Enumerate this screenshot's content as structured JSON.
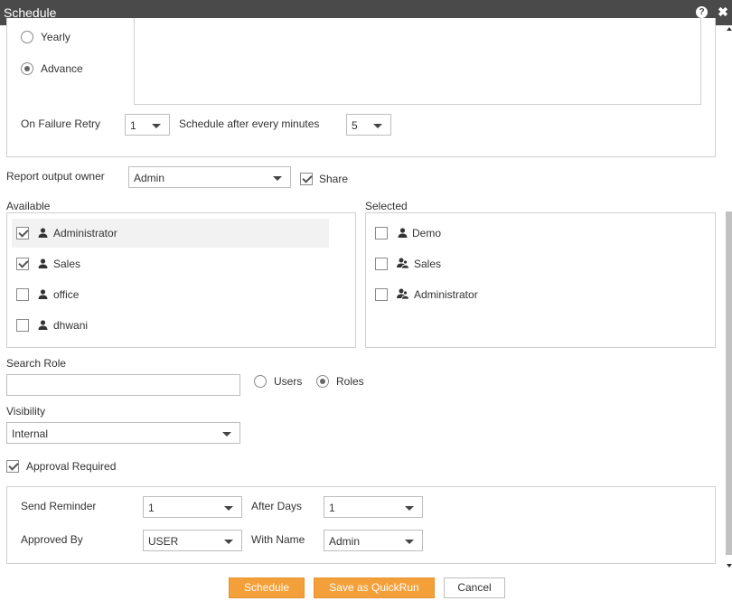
{
  "window": {
    "title": "Schedule",
    "help_icon": "question-icon",
    "close_icon": "close-icon"
  },
  "frequency": {
    "yearly_label": "Yearly",
    "advance_label": "Advance",
    "selected": "Advance"
  },
  "retry": {
    "label": "On Failure Retry",
    "value": "1",
    "schedule_label": "Schedule after every minutes",
    "schedule_value": "5"
  },
  "owner": {
    "label": "Report output owner",
    "value": "Admin",
    "share_label": "Share",
    "share_checked": true
  },
  "available": {
    "label": "Available",
    "items": [
      {
        "label": "Administrator",
        "checked": true,
        "icon": "user-icon"
      },
      {
        "label": "Sales",
        "checked": true,
        "icon": "user-icon"
      },
      {
        "label": "office",
        "checked": false,
        "icon": "user-icon"
      },
      {
        "label": "dhwani",
        "checked": false,
        "icon": "user-icon"
      }
    ]
  },
  "selected": {
    "label": "Selected",
    "items": [
      {
        "label": "Demo",
        "checked": false,
        "icon": "user-icon"
      },
      {
        "label": "Sales",
        "checked": false,
        "icon": "group-icon"
      },
      {
        "label": "Administrator",
        "checked": false,
        "icon": "group-icon"
      }
    ]
  },
  "search": {
    "label": "Search Role",
    "value": "",
    "users_label": "Users",
    "roles_label": "Roles",
    "selected": "Roles"
  },
  "visibility": {
    "label": "Visibility",
    "value": "Internal"
  },
  "approval": {
    "label": "Approval Required",
    "checked": true,
    "send_reminder_label": "Send Reminder",
    "send_reminder_value": "1",
    "after_days_label": "After Days",
    "after_days_value": "1",
    "approved_by_label": "Approved By",
    "approved_by_value": "USER",
    "with_name_label": "With Name",
    "with_name_value": "Admin"
  },
  "buttons": {
    "schedule": "Schedule",
    "quickrun": "Save as QuickRun",
    "cancel": "Cancel"
  },
  "colors": {
    "accent": "#f4a03a",
    "titlebar": "#4a4a4a"
  }
}
